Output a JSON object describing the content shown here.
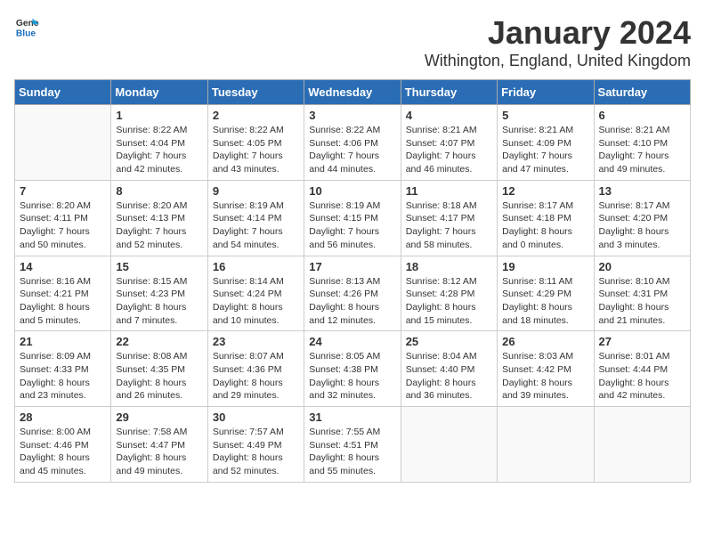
{
  "logo": {
    "general": "General",
    "blue": "Blue"
  },
  "title": {
    "month": "January 2024",
    "location": "Withington, England, United Kingdom"
  },
  "weekdays": [
    "Sunday",
    "Monday",
    "Tuesday",
    "Wednesday",
    "Thursday",
    "Friday",
    "Saturday"
  ],
  "weeks": [
    [
      {
        "day": "",
        "sunrise": "",
        "sunset": "",
        "daylight": ""
      },
      {
        "day": "1",
        "sunrise": "Sunrise: 8:22 AM",
        "sunset": "Sunset: 4:04 PM",
        "daylight": "Daylight: 7 hours and 42 minutes."
      },
      {
        "day": "2",
        "sunrise": "Sunrise: 8:22 AM",
        "sunset": "Sunset: 4:05 PM",
        "daylight": "Daylight: 7 hours and 43 minutes."
      },
      {
        "day": "3",
        "sunrise": "Sunrise: 8:22 AM",
        "sunset": "Sunset: 4:06 PM",
        "daylight": "Daylight: 7 hours and 44 minutes."
      },
      {
        "day": "4",
        "sunrise": "Sunrise: 8:21 AM",
        "sunset": "Sunset: 4:07 PM",
        "daylight": "Daylight: 7 hours and 46 minutes."
      },
      {
        "day": "5",
        "sunrise": "Sunrise: 8:21 AM",
        "sunset": "Sunset: 4:09 PM",
        "daylight": "Daylight: 7 hours and 47 minutes."
      },
      {
        "day": "6",
        "sunrise": "Sunrise: 8:21 AM",
        "sunset": "Sunset: 4:10 PM",
        "daylight": "Daylight: 7 hours and 49 minutes."
      }
    ],
    [
      {
        "day": "7",
        "sunrise": "Sunrise: 8:20 AM",
        "sunset": "Sunset: 4:11 PM",
        "daylight": "Daylight: 7 hours and 50 minutes."
      },
      {
        "day": "8",
        "sunrise": "Sunrise: 8:20 AM",
        "sunset": "Sunset: 4:13 PM",
        "daylight": "Daylight: 7 hours and 52 minutes."
      },
      {
        "day": "9",
        "sunrise": "Sunrise: 8:19 AM",
        "sunset": "Sunset: 4:14 PM",
        "daylight": "Daylight: 7 hours and 54 minutes."
      },
      {
        "day": "10",
        "sunrise": "Sunrise: 8:19 AM",
        "sunset": "Sunset: 4:15 PM",
        "daylight": "Daylight: 7 hours and 56 minutes."
      },
      {
        "day": "11",
        "sunrise": "Sunrise: 8:18 AM",
        "sunset": "Sunset: 4:17 PM",
        "daylight": "Daylight: 7 hours and 58 minutes."
      },
      {
        "day": "12",
        "sunrise": "Sunrise: 8:17 AM",
        "sunset": "Sunset: 4:18 PM",
        "daylight": "Daylight: 8 hours and 0 minutes."
      },
      {
        "day": "13",
        "sunrise": "Sunrise: 8:17 AM",
        "sunset": "Sunset: 4:20 PM",
        "daylight": "Daylight: 8 hours and 3 minutes."
      }
    ],
    [
      {
        "day": "14",
        "sunrise": "Sunrise: 8:16 AM",
        "sunset": "Sunset: 4:21 PM",
        "daylight": "Daylight: 8 hours and 5 minutes."
      },
      {
        "day": "15",
        "sunrise": "Sunrise: 8:15 AM",
        "sunset": "Sunset: 4:23 PM",
        "daylight": "Daylight: 8 hours and 7 minutes."
      },
      {
        "day": "16",
        "sunrise": "Sunrise: 8:14 AM",
        "sunset": "Sunset: 4:24 PM",
        "daylight": "Daylight: 8 hours and 10 minutes."
      },
      {
        "day": "17",
        "sunrise": "Sunrise: 8:13 AM",
        "sunset": "Sunset: 4:26 PM",
        "daylight": "Daylight: 8 hours and 12 minutes."
      },
      {
        "day": "18",
        "sunrise": "Sunrise: 8:12 AM",
        "sunset": "Sunset: 4:28 PM",
        "daylight": "Daylight: 8 hours and 15 minutes."
      },
      {
        "day": "19",
        "sunrise": "Sunrise: 8:11 AM",
        "sunset": "Sunset: 4:29 PM",
        "daylight": "Daylight: 8 hours and 18 minutes."
      },
      {
        "day": "20",
        "sunrise": "Sunrise: 8:10 AM",
        "sunset": "Sunset: 4:31 PM",
        "daylight": "Daylight: 8 hours and 21 minutes."
      }
    ],
    [
      {
        "day": "21",
        "sunrise": "Sunrise: 8:09 AM",
        "sunset": "Sunset: 4:33 PM",
        "daylight": "Daylight: 8 hours and 23 minutes."
      },
      {
        "day": "22",
        "sunrise": "Sunrise: 8:08 AM",
        "sunset": "Sunset: 4:35 PM",
        "daylight": "Daylight: 8 hours and 26 minutes."
      },
      {
        "day": "23",
        "sunrise": "Sunrise: 8:07 AM",
        "sunset": "Sunset: 4:36 PM",
        "daylight": "Daylight: 8 hours and 29 minutes."
      },
      {
        "day": "24",
        "sunrise": "Sunrise: 8:05 AM",
        "sunset": "Sunset: 4:38 PM",
        "daylight": "Daylight: 8 hours and 32 minutes."
      },
      {
        "day": "25",
        "sunrise": "Sunrise: 8:04 AM",
        "sunset": "Sunset: 4:40 PM",
        "daylight": "Daylight: 8 hours and 36 minutes."
      },
      {
        "day": "26",
        "sunrise": "Sunrise: 8:03 AM",
        "sunset": "Sunset: 4:42 PM",
        "daylight": "Daylight: 8 hours and 39 minutes."
      },
      {
        "day": "27",
        "sunrise": "Sunrise: 8:01 AM",
        "sunset": "Sunset: 4:44 PM",
        "daylight": "Daylight: 8 hours and 42 minutes."
      }
    ],
    [
      {
        "day": "28",
        "sunrise": "Sunrise: 8:00 AM",
        "sunset": "Sunset: 4:46 PM",
        "daylight": "Daylight: 8 hours and 45 minutes."
      },
      {
        "day": "29",
        "sunrise": "Sunrise: 7:58 AM",
        "sunset": "Sunset: 4:47 PM",
        "daylight": "Daylight: 8 hours and 49 minutes."
      },
      {
        "day": "30",
        "sunrise": "Sunrise: 7:57 AM",
        "sunset": "Sunset: 4:49 PM",
        "daylight": "Daylight: 8 hours and 52 minutes."
      },
      {
        "day": "31",
        "sunrise": "Sunrise: 7:55 AM",
        "sunset": "Sunset: 4:51 PM",
        "daylight": "Daylight: 8 hours and 55 minutes."
      },
      {
        "day": "",
        "sunrise": "",
        "sunset": "",
        "daylight": ""
      },
      {
        "day": "",
        "sunrise": "",
        "sunset": "",
        "daylight": ""
      },
      {
        "day": "",
        "sunrise": "",
        "sunset": "",
        "daylight": ""
      }
    ]
  ]
}
